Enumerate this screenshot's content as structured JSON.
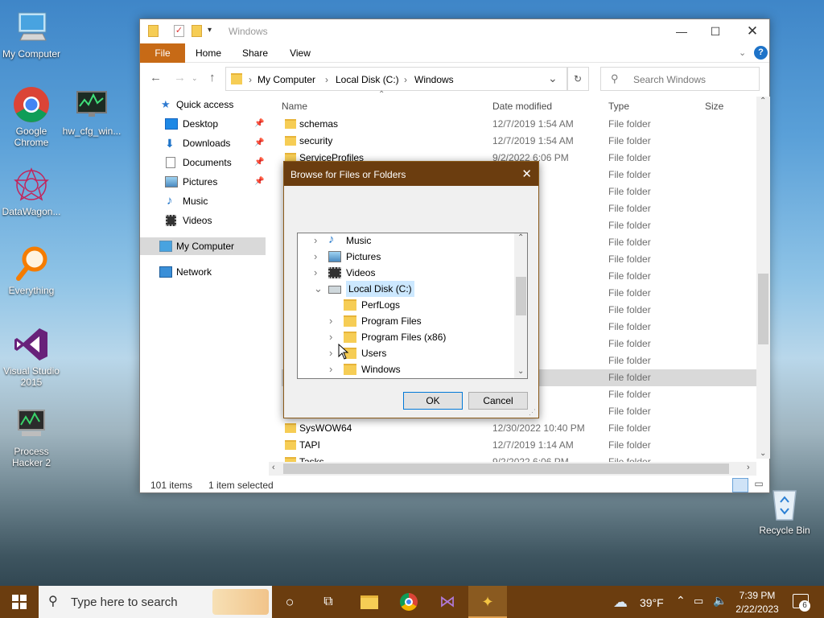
{
  "desktop": {
    "icons": [
      {
        "label": "My Computer"
      },
      {
        "label": "Google Chrome"
      },
      {
        "label": "hw_cfg_win..."
      },
      {
        "label": "DataWagon..."
      },
      {
        "label": "Everything"
      },
      {
        "label": "Visual Studio 2015"
      },
      {
        "label": "Process Hacker 2"
      },
      {
        "label": "Recycle Bin"
      }
    ]
  },
  "explorer": {
    "title": "Windows",
    "tabs": {
      "file": "File",
      "home": "Home",
      "share": "Share",
      "view": "View"
    },
    "breadcrumb": [
      "My Computer",
      "Local Disk (C:)",
      "Windows"
    ],
    "search_placeholder": "Search Windows",
    "columns": {
      "name": "Name",
      "date": "Date modified",
      "type": "Type",
      "size": "Size"
    },
    "nav": [
      {
        "label": "Quick access",
        "icon": "star-icon"
      },
      {
        "label": "Desktop",
        "icon": "desktop-icon"
      },
      {
        "label": "Downloads",
        "icon": "download-icon"
      },
      {
        "label": "Documents",
        "icon": "document-icon"
      },
      {
        "label": "Pictures",
        "icon": "pictures-icon"
      },
      {
        "label": "Music",
        "icon": "music-icon"
      },
      {
        "label": "Videos",
        "icon": "video-icon"
      },
      {
        "label": "My Computer",
        "icon": "computer-icon"
      },
      {
        "label": "Network",
        "icon": "network-icon"
      }
    ],
    "rows": [
      {
        "name": "schemas",
        "date": "12/7/2019 1:54 AM",
        "type": "File folder"
      },
      {
        "name": "security",
        "date": "12/7/2019 1:54 AM",
        "type": "File folder"
      },
      {
        "name": "ServiceProfiles",
        "date": "9/2/2022 6:06 PM",
        "type": "File folder"
      },
      {
        "name": "",
        "date": ":30 AM",
        "type": "File folder"
      },
      {
        "name": "",
        "date": ":06 PM",
        "type": "File folder"
      },
      {
        "name": "",
        "date": ":18 AM",
        "type": "File folder"
      },
      {
        "name": "",
        "date": ":31 AM",
        "type": "File folder"
      },
      {
        "name": "",
        "date": ":31 AM",
        "type": "File folder"
      },
      {
        "name": "",
        "date": ":31 AM",
        "type": "File folder"
      },
      {
        "name": "",
        "date": ":17 AM",
        "type": "File folder"
      },
      {
        "name": "",
        "date": ":14 AM",
        "type": "File folder"
      },
      {
        "name": "",
        "date": ":14 AM",
        "type": "File folder"
      },
      {
        "name": "",
        "date": "9:59 PM",
        "type": "File folder"
      },
      {
        "name": "",
        "date": ":14 AM",
        "type": "File folder"
      },
      {
        "name": "",
        "date": ":33 PM",
        "type": "File folder"
      },
      {
        "name": "",
        "date": ":54 AM",
        "type": "File folder"
      },
      {
        "name": "",
        "date": "2:19 AM",
        "type": "File folder"
      },
      {
        "name": "",
        "date": ":31 AM",
        "type": "File folder"
      },
      {
        "name": "SysWOW64",
        "date": "12/30/2022 10:40 PM",
        "type": "File folder"
      },
      {
        "name": "TAPI",
        "date": "12/7/2019 1:14 AM",
        "type": "File folder"
      },
      {
        "name": "Tasks",
        "date": "9/2/2022 6:06 PM",
        "type": "File folder"
      }
    ],
    "status_count": "101 items",
    "status_selected": "1 item selected"
  },
  "dialog": {
    "title": "Browse for Files or Folders",
    "tree": [
      {
        "label": "Music",
        "expander": ">"
      },
      {
        "label": "Pictures",
        "expander": ">"
      },
      {
        "label": "Videos",
        "expander": ">"
      },
      {
        "label": "Local Disk (C:)",
        "expander": "v"
      },
      {
        "label": "PerfLogs",
        "expander": ""
      },
      {
        "label": "Program Files",
        "expander": ">"
      },
      {
        "label": "Program Files (x86)",
        "expander": ">"
      },
      {
        "label": "Users",
        "expander": ">"
      },
      {
        "label": "Windows",
        "expander": ">"
      }
    ],
    "ok": "OK",
    "cancel": "Cancel"
  },
  "taskbar": {
    "search_placeholder": "Type here to search",
    "weather": "39°F",
    "time": "7:39 PM",
    "date": "2/22/2023",
    "notifications": "6"
  }
}
